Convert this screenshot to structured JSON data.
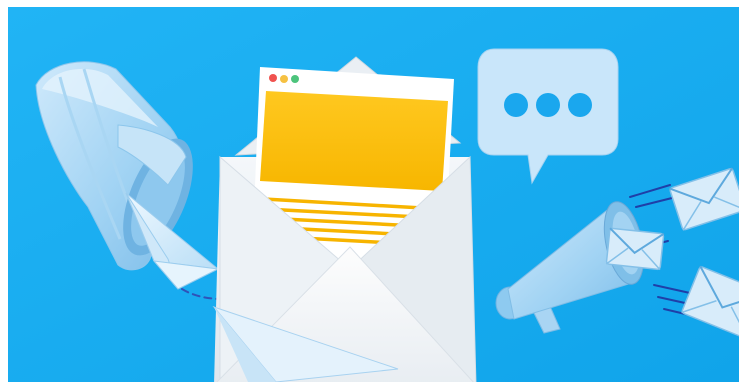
{
  "scene": {
    "background_color": "#1aaef2",
    "elements": [
      "mailbox",
      "paper-plane",
      "open-envelope",
      "browser-window-card",
      "speech-bubble",
      "megaphone",
      "flying-envelopes",
      "dashed-flight-path"
    ],
    "window_dots": [
      "#f0524f",
      "#f6c142",
      "#4cc47c"
    ],
    "card_color": "#fcc20a",
    "speech_bubble_dots": 3
  }
}
